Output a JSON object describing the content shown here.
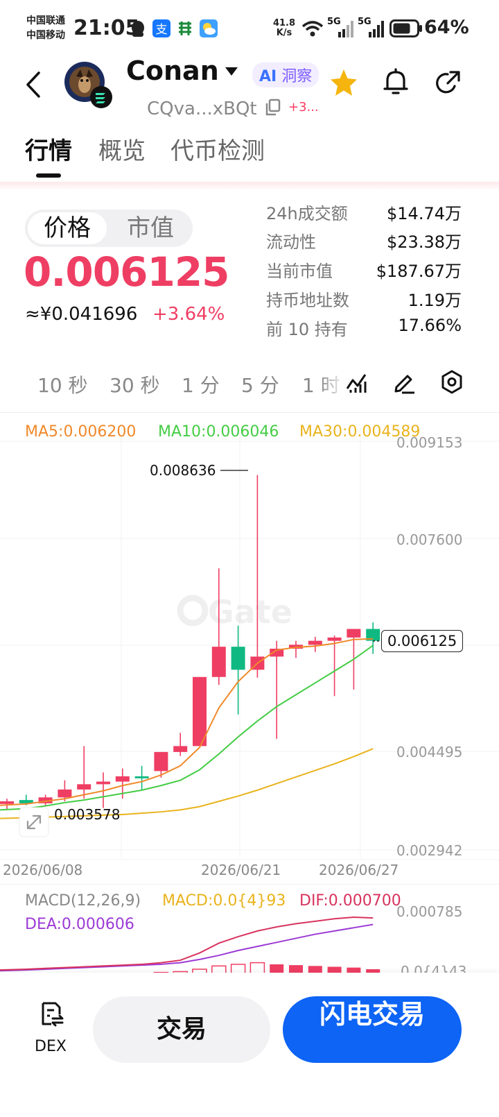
{
  "status_bar": {
    "carrier_1": "中国联通",
    "carrier_2": "中国移动",
    "time": "21:05",
    "net_speed_value": "41.8",
    "net_speed_unit": "K/s",
    "signal_1_label": "5G",
    "signal_2_label": "5G",
    "battery": "64%"
  },
  "header": {
    "token_name": "Conan",
    "ai_badge": "洞察",
    "ai_badge_prefix": "AI",
    "address": "CQva...xBQt",
    "address_extra": "+3..."
  },
  "tabs": [
    {
      "label": "行情"
    },
    {
      "label": "概览"
    },
    {
      "label": "代币检测"
    }
  ],
  "price_section": {
    "toggle_on": "价格",
    "toggle_off": "市值",
    "price": "0.006125",
    "cny_price": "≈¥0.041696",
    "change_pct": "+3.64%"
  },
  "stats": [
    {
      "label": "24h成交额",
      "value": "$14.74万"
    },
    {
      "label": "流动性",
      "value": "$23.38万"
    },
    {
      "label": "当前市值",
      "value": "$187.67万"
    },
    {
      "label": "持币地址数",
      "value": "1.19万"
    },
    {
      "label": "前 10 持有",
      "value": "17.66%"
    }
  ],
  "intervals": [
    "10 秒",
    "30 秒",
    "1 分",
    "5 分",
    "1 时"
  ],
  "legend": {
    "ma5": "MA5:0.006200",
    "ma10": "MA10:0.006046",
    "ma30": "MA30:0.004589",
    "macd_params": "MACD(12,26,9)",
    "macd": "MACD:0.0{4}93",
    "dif": "DIF:0.000700",
    "dea": "DEA:0.000606"
  },
  "colors": {
    "up": "#ef3e63",
    "down": "#10b981",
    "ma5": "#f0892a",
    "ma10": "#44cc44",
    "ma30": "#e9b31c",
    "dif": "#d8335e",
    "dea": "#9c3ad6",
    "accent_blue": "#0d64f5"
  },
  "chart_data": {
    "type": "candlestick",
    "y_axis_ticks": [
      "0.009153",
      "0.007600",
      "0.004495",
      "0.002942"
    ],
    "x_axis_ticks": [
      "2026/06/08",
      "2026/06/21",
      "2026/06/27"
    ],
    "high_annotation": "0.008636",
    "low_annotation": "0.003578",
    "last_price_tag": "0.006125",
    "macd_axis_top": "0.000785",
    "macd_axis_mid": "0.0{4}43",
    "candles": [
      {
        "o": 0.00364,
        "h": 0.00372,
        "l": 0.00355,
        "c": 0.00368
      },
      {
        "o": 0.0037,
        "h": 0.00378,
        "l": 0.00362,
        "c": 0.00365
      },
      {
        "o": 0.00365,
        "h": 0.00378,
        "l": 0.0036,
        "c": 0.00374
      },
      {
        "o": 0.00374,
        "h": 0.004,
        "l": 0.00368,
        "c": 0.00386
      },
      {
        "o": 0.00386,
        "h": 0.00452,
        "l": 0.00372,
        "c": 0.00394
      },
      {
        "o": 0.00394,
        "h": 0.00412,
        "l": 0.00358,
        "c": 0.00398
      },
      {
        "o": 0.00398,
        "h": 0.00418,
        "l": 0.00372,
        "c": 0.00406
      },
      {
        "o": 0.00406,
        "h": 0.00422,
        "l": 0.00385,
        "c": 0.00403
      },
      {
        "o": 0.00414,
        "h": 0.00443,
        "l": 0.00404,
        "c": 0.00443
      },
      {
        "o": 0.00443,
        "h": 0.00472,
        "l": 0.00437,
        "c": 0.00452
      },
      {
        "o": 0.00452,
        "h": 0.00557,
        "l": 0.00452,
        "c": 0.00557
      },
      {
        "o": 0.00557,
        "h": 0.00722,
        "l": 0.00545,
        "c": 0.00603
      },
      {
        "o": 0.00603,
        "h": 0.00635,
        "l": 0.005,
        "c": 0.00568
      },
      {
        "o": 0.00568,
        "h": 0.00864,
        "l": 0.00556,
        "c": 0.00588
      },
      {
        "o": 0.00588,
        "h": 0.00612,
        "l": 0.00463,
        "c": 0.006
      },
      {
        "o": 0.006,
        "h": 0.00612,
        "l": 0.00586,
        "c": 0.00606
      },
      {
        "o": 0.00606,
        "h": 0.00618,
        "l": 0.00595,
        "c": 0.00612
      },
      {
        "o": 0.00612,
        "h": 0.0062,
        "l": 0.00528,
        "c": 0.00617
      },
      {
        "o": 0.00617,
        "h": 0.0063,
        "l": 0.00538,
        "c": 0.0063
      },
      {
        "o": 0.0063,
        "h": 0.0064,
        "l": 0.00592,
        "c": 0.00612
      }
    ],
    "ma5": [
      0.00362,
      0.00364,
      0.00368,
      0.00372,
      0.00378,
      0.00384,
      0.00392,
      0.00398,
      0.00408,
      0.00422,
      0.0045,
      0.0051,
      0.0055,
      0.00578,
      0.00598,
      0.00602,
      0.00604,
      0.00608,
      0.00614,
      0.00615
    ],
    "ma10": [
      0.00355,
      0.00357,
      0.00361,
      0.00366,
      0.0037,
      0.00375,
      0.0038,
      0.00385,
      0.00392,
      0.004,
      0.00416,
      0.0044,
      0.00466,
      0.0049,
      0.00512,
      0.0053,
      0.00548,
      0.00566,
      0.00584,
      0.00605
    ],
    "ma30": [
      0.00342,
      0.00343,
      0.00344,
      0.00345,
      0.00346,
      0.00347,
      0.00348,
      0.0035,
      0.00352,
      0.00355,
      0.0036,
      0.00368,
      0.00376,
      0.00385,
      0.00395,
      0.00405,
      0.00415,
      0.00425,
      0.00436,
      0.00448
    ],
    "macd_hist": [
      1e-05,
      1e-05,
      1e-05,
      1e-05,
      1e-05,
      1e-05,
      1e-05,
      1e-05,
      2e-05,
      3e-05,
      6e-05,
      0.0001,
      0.00012,
      0.00014,
      0.00012,
      0.00011,
      0.0001,
      9e-05,
      8e-05,
      6e-05
    ],
    "macd_hist_hollow": [
      false,
      false,
      false,
      false,
      false,
      false,
      false,
      false,
      true,
      true,
      true,
      true,
      true,
      true,
      false,
      false,
      false,
      false,
      false,
      false
    ],
    "dif": [
      5e-05,
      6e-05,
      7e-05,
      8e-05,
      9e-05,
      0.0001,
      0.00011,
      0.00012,
      0.00014,
      0.00017,
      0.00026,
      0.00038,
      0.00046,
      0.00053,
      0.00058,
      0.00062,
      0.00065,
      0.00068,
      0.0007,
      0.00069
    ],
    "dea": [
      4e-05,
      5e-05,
      6e-05,
      7e-05,
      8e-05,
      9e-05,
      0.0001,
      0.00011,
      0.00012,
      0.00014,
      0.00018,
      0.00023,
      0.00029,
      0.00034,
      0.00039,
      0.00044,
      0.00049,
      0.00053,
      0.00057,
      0.00061
    ]
  }
}
